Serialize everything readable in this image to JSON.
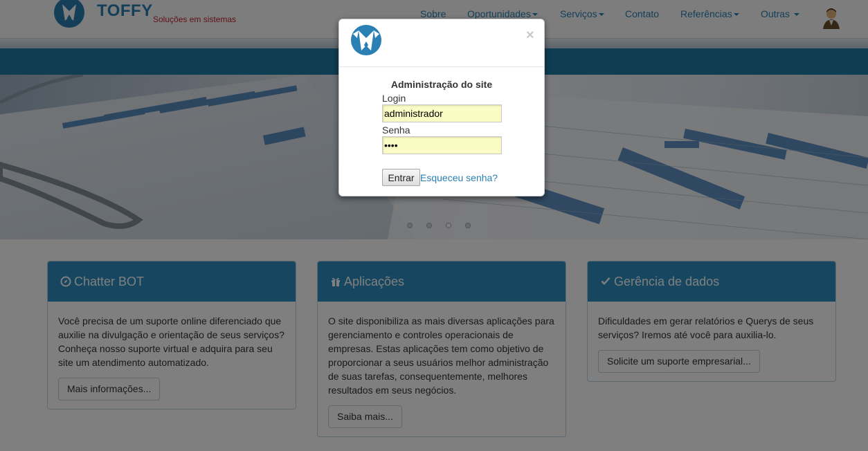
{
  "brand": {
    "name": "TOFFY",
    "tagline": "Soluções em sistemas"
  },
  "nav": {
    "items": [
      {
        "label": "Sobre",
        "dropdown": false
      },
      {
        "label": "Oportunidades",
        "dropdown": true
      },
      {
        "label": "Serviços",
        "dropdown": true
      },
      {
        "label": "Contato",
        "dropdown": false
      },
      {
        "label": "Referências",
        "dropdown": true
      },
      {
        "label": "Outras",
        "dropdown": true
      }
    ]
  },
  "carousel": {
    "slide_count": 4,
    "active_index": 2
  },
  "panels": [
    {
      "icon": "compass-icon",
      "title": "Chatter BOT",
      "text": "Você precisa de um suporte online diferenciado que auxilie na divulgação e orientação de seus serviços? Conheça nosso suporte virtual e adquira para seu site um atendimento automatizado.",
      "button": "Mais informações..."
    },
    {
      "icon": "gift-icon",
      "title": "Aplicações",
      "text": "O site disponibiliza as mais diversas aplicações para gerenciamento e controles operacionais de empresas. Estas aplicações tem como objetivo de proporcionar a seus usuários melhor administração de suas tarefas, consequentemente, melhores resultados em seus negócios.",
      "button": "Saiba mais..."
    },
    {
      "icon": "check-icon",
      "title": "Gerência de dados",
      "text": "Dificuldades em gerar relatórios e Querys de seus serviços? Iremos até você para auxilia-lo.",
      "button": "Solicite um suporte empresarial..."
    }
  ],
  "modal": {
    "close_symbol": "×",
    "title": "Administração do site",
    "login_label": "Login",
    "login_value": "administrador",
    "password_label": "Senha",
    "password_value": "••••",
    "submit_label": "Entrar",
    "forgot_label": "Esqueceu senha?"
  },
  "colors": {
    "accent": "#2a7fb3",
    "panel_heading": "#2e8fc0",
    "tagline": "#c0272d",
    "autofill": "#fbfbc5"
  }
}
